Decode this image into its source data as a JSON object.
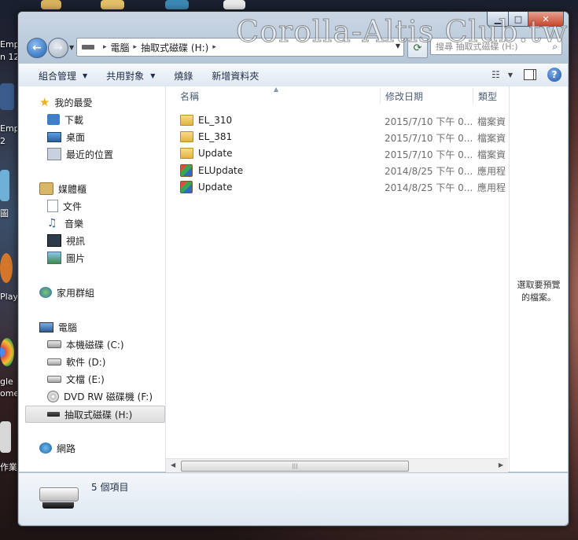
{
  "watermark": "Corolla-Altis Club.tw",
  "desktop": {
    "labels": [
      "Emp",
      "n 12",
      "Emp",
      "2",
      "圖",
      "Play",
      "gle",
      "ome",
      "作業"
    ]
  },
  "address_bar": {
    "crumbs": [
      "電腦",
      "抽取式磁碟 (H:)"
    ],
    "search_placeholder": "搜尋 抽取式磁碟 (H:)"
  },
  "toolbar": {
    "organize": "組合管理",
    "share": "共用對象",
    "burn": "燒錄",
    "new_folder": "新增資料夾"
  },
  "nav_pane": {
    "favorites": "我的最愛",
    "downloads": "下載",
    "desktop": "桌面",
    "recent": "最近的位置",
    "libraries": "媒體櫃",
    "documents": "文件",
    "music": "音樂",
    "videos": "視訊",
    "pictures": "圖片",
    "homegroup": "家用群組",
    "computer": "電腦",
    "drive_c": "本機磁碟 (C:)",
    "drive_d": "軟件 (D:)",
    "drive_e": "文檔 (E:)",
    "drive_f": "DVD RW 磁碟機 (F:)",
    "drive_h": "抽取式磁碟 (H:)",
    "network": "網路"
  },
  "columns": {
    "name": "名稱",
    "date": "修改日期",
    "type": "類型"
  },
  "files": [
    {
      "name": "EL_310",
      "date": "2015/7/10 下午 0...",
      "type": "檔案資",
      "kind": "folder"
    },
    {
      "name": "EL_381",
      "date": "2015/7/10 下午 0...",
      "type": "檔案資",
      "kind": "folder"
    },
    {
      "name": "Update",
      "date": "2015/7/10 下午 0...",
      "type": "檔案資",
      "kind": "folder"
    },
    {
      "name": "ELUpdate",
      "date": "2014/8/25 下午 0...",
      "type": "應用程",
      "kind": "app"
    },
    {
      "name": "Update",
      "date": "2014/8/25 下午 0...",
      "type": "應用程",
      "kind": "app"
    }
  ],
  "preview": {
    "line1": "選取要預覽",
    "line2": "的檔案。"
  },
  "status": {
    "item_count": "5 個項目"
  }
}
